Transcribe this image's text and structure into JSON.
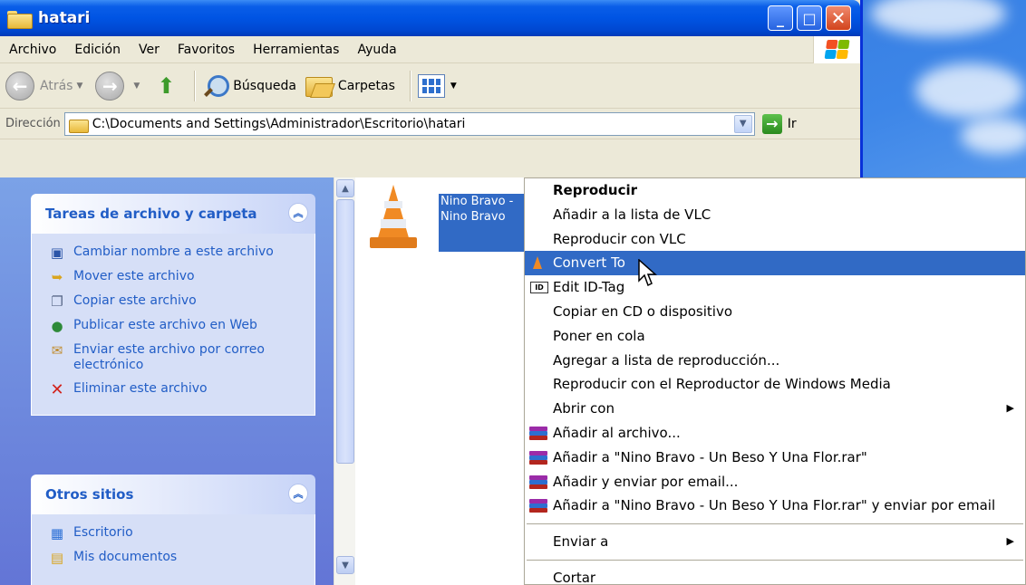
{
  "window": {
    "title": "hatari"
  },
  "menubar": [
    "Archivo",
    "Edición",
    "Ver",
    "Favoritos",
    "Herramientas",
    "Ayuda"
  ],
  "toolbar": {
    "back_label": "Atrás",
    "search_label": "Búsqueda",
    "folders_label": "Carpetas"
  },
  "address": {
    "label": "Dirección",
    "path": "C:\\Documents and Settings\\Administrador\\Escritorio\\hatari",
    "go_label": "Ir"
  },
  "tasks_panel": {
    "title": "Tareas de archivo y carpeta",
    "items": [
      {
        "label": "Cambiar nombre a este archivo",
        "icon": "rename-icon"
      },
      {
        "label": "Mover este archivo",
        "icon": "move-icon"
      },
      {
        "label": "Copiar este archivo",
        "icon": "copy-icon"
      },
      {
        "label": "Publicar este archivo en Web",
        "icon": "globe-icon"
      },
      {
        "label": "Enviar este archivo por correo electrónico",
        "icon": "mail-icon"
      },
      {
        "label": "Eliminar este archivo",
        "icon": "delete-icon"
      }
    ]
  },
  "other_panel": {
    "title": "Otros sitios",
    "items": [
      {
        "label": "Escritorio",
        "icon": "desktop-icon"
      },
      {
        "label": "Mis documentos",
        "icon": "documents-icon"
      }
    ]
  },
  "file": {
    "name_line1": "Nino Bravo -",
    "name_line2": "Nino Bravo",
    "icon": "vlc-cone-icon"
  },
  "context_menu": {
    "items": [
      {
        "label": "Reproducir",
        "bold": true
      },
      {
        "label": "Añadir a la lista de VLC"
      },
      {
        "label": "Reproducir con VLC"
      },
      {
        "label": "Convert To",
        "highlighted": true,
        "icon": "vlc"
      },
      {
        "label": "Edit ID-Tag",
        "icon": "id"
      },
      {
        "label": "Copiar en CD o dispositivo"
      },
      {
        "label": "Poner en cola"
      },
      {
        "label": "Agregar a lista de reproducción..."
      },
      {
        "label": "Reproducir con el Reproductor de Windows Media"
      },
      {
        "label": "Abrir con",
        "submenu": true
      },
      {
        "label": "Añadir al archivo...",
        "icon": "rar"
      },
      {
        "label": "Añadir a \"Nino Bravo - Un Beso Y Una Flor.rar\"",
        "icon": "rar"
      },
      {
        "label": "Añadir y enviar por email...",
        "icon": "rar"
      },
      {
        "label": "Añadir a \"Nino Bravo - Un Beso Y Una Flor.rar\" y enviar por email",
        "icon": "rar"
      },
      {
        "separator": true
      },
      {
        "label": "Enviar a",
        "submenu": true
      },
      {
        "separator": true
      },
      {
        "label": "Cortar"
      }
    ]
  },
  "colors": {
    "title_blue": "#0054e3",
    "selection": "#316ac5",
    "task_link": "#215dc6"
  }
}
